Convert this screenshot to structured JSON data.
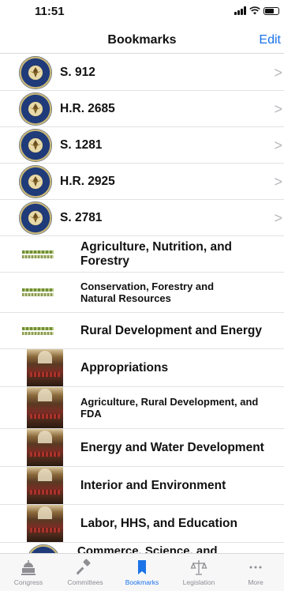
{
  "status_bar": {
    "time": "11:51"
  },
  "nav": {
    "title": "Bookmarks",
    "edit_label": "Edit"
  },
  "bills": [
    {
      "label": "S. 912",
      "chevron": ">"
    },
    {
      "label": "H.R. 2685",
      "chevron": ">"
    },
    {
      "label": "S. 1281",
      "chevron": ">"
    },
    {
      "label": "H.R. 2925",
      "chevron": ">"
    },
    {
      "label": "S. 2781",
      "chevron": ">"
    }
  ],
  "committees": [
    {
      "label": "Agriculture, Nutrition, and Forestry"
    },
    {
      "label": "Conservation, Forestry and Natural Resources"
    },
    {
      "label": "Rural Development and Energy"
    },
    {
      "label": "Appropriations"
    },
    {
      "label": "Agriculture, Rural Development, and FDA"
    },
    {
      "label": "Energy and Water Development"
    },
    {
      "label": "Interior and Environment"
    },
    {
      "label": "Labor, HHS, and Education"
    },
    {
      "label": "Commerce, Science, and"
    }
  ],
  "tabs": [
    {
      "label": "Congress",
      "icon": "capitol-icon"
    },
    {
      "label": "Committees",
      "icon": "gavel-icon"
    },
    {
      "label": "Bookmarks",
      "icon": "bookmark-icon",
      "active": true
    },
    {
      "label": "Legislation",
      "icon": "scales-icon"
    },
    {
      "label": "More",
      "icon": "more-icon"
    }
  ],
  "colors": {
    "accent": "#1a73e8",
    "inactive": "#8e8e93"
  }
}
